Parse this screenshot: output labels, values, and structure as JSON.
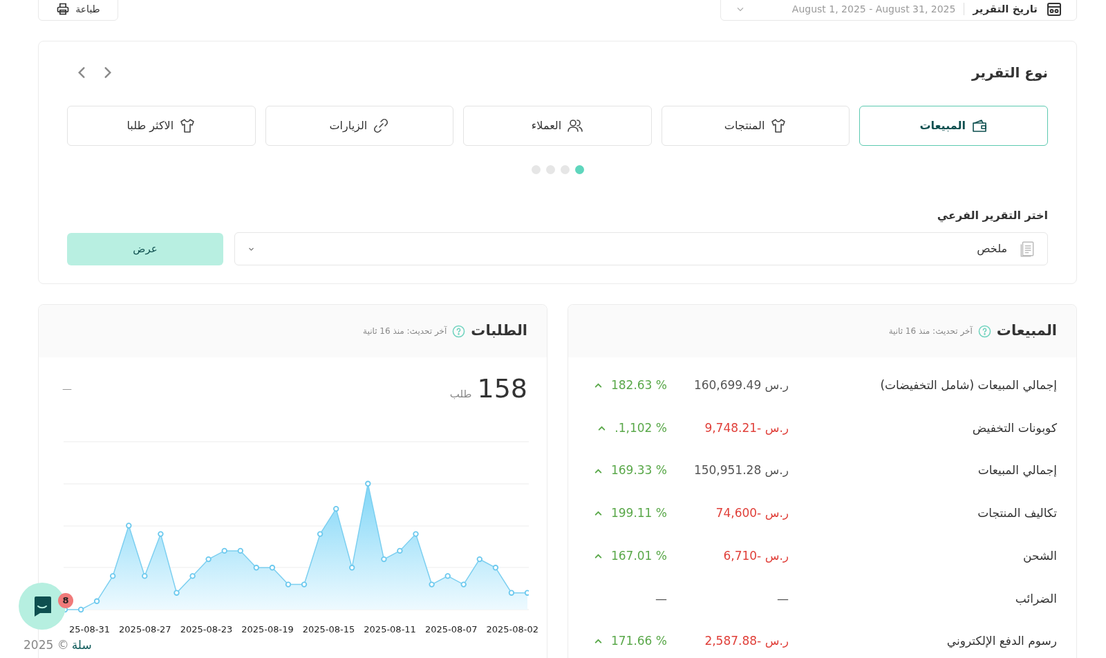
{
  "toolbar": {
    "print_button": "طباعة",
    "date_label": "تاريخ التقرير",
    "date_range": "August 1, 2025 - August 31, 2025"
  },
  "report_type": {
    "title": "نوع التقرير",
    "tabs": [
      {
        "label": "المبيعات",
        "kind": "wallet",
        "selected": true
      },
      {
        "label": "المنتجات",
        "kind": "shirt",
        "selected": false
      },
      {
        "label": "العملاء",
        "kind": "users",
        "selected": false
      },
      {
        "label": "الزيارات",
        "kind": "link",
        "selected": false
      },
      {
        "label": "الاكثر طلبا",
        "kind": "shirt",
        "selected": false
      }
    ],
    "pages": [
      {
        "selected": true
      },
      {
        "selected": false
      },
      {
        "selected": false
      },
      {
        "selected": false
      }
    ],
    "subreport_label": "اختر التقرير الفرعي",
    "subreport_value": "ملخص",
    "show_button": "عرض"
  },
  "sales_card": {
    "title": "المبيعات",
    "updated": "آخر تحديث: منذ 16 ثانية",
    "rows": [
      {
        "label": "إجمالي المبيعات (شامل التخفيضات)",
        "value": "ر.س 160,699.49",
        "negative": false,
        "change": "182.63 %",
        "up": true
      },
      {
        "label": "كوبونات التخفيض",
        "value": "ر.س -9,748.21",
        "negative": true,
        "change": ".1,102 %",
        "up": true
      },
      {
        "label": "إجمالي المبيعات",
        "value": "ر.س 150,951.28",
        "negative": false,
        "change": "169.33 %",
        "up": true
      },
      {
        "label": "تكاليف المنتجات",
        "value": "ر.س -74,600",
        "negative": true,
        "change": "199.11 %",
        "up": true
      },
      {
        "label": "الشحن",
        "value": "ر.س -6,710",
        "negative": true,
        "change": "167.01 %",
        "up": true
      },
      {
        "label": "الضرائب",
        "value": "—",
        "negative": false,
        "change": "—",
        "up": false
      },
      {
        "label": "رسوم الدفع الإلكتروني",
        "value": "ر.س -2,587.88",
        "negative": true,
        "change": "171.66 %",
        "up": true
      }
    ]
  },
  "orders_card": {
    "title": "الطلبات",
    "updated": "آخر تحديث: منذ 16 ثانية",
    "total": "158",
    "unit": "طلب",
    "change": "—",
    "x_labels": [
      "2025-08-02",
      "2025-08-07",
      "2025-08-11",
      "2025-08-15",
      "2025-08-19",
      "2025-08-23",
      "2025-08-27",
      "25-08-31"
    ]
  },
  "chat": {
    "badge": "8"
  },
  "footer": {
    "brand": "سلة",
    "copyright": "© 2025"
  }
}
